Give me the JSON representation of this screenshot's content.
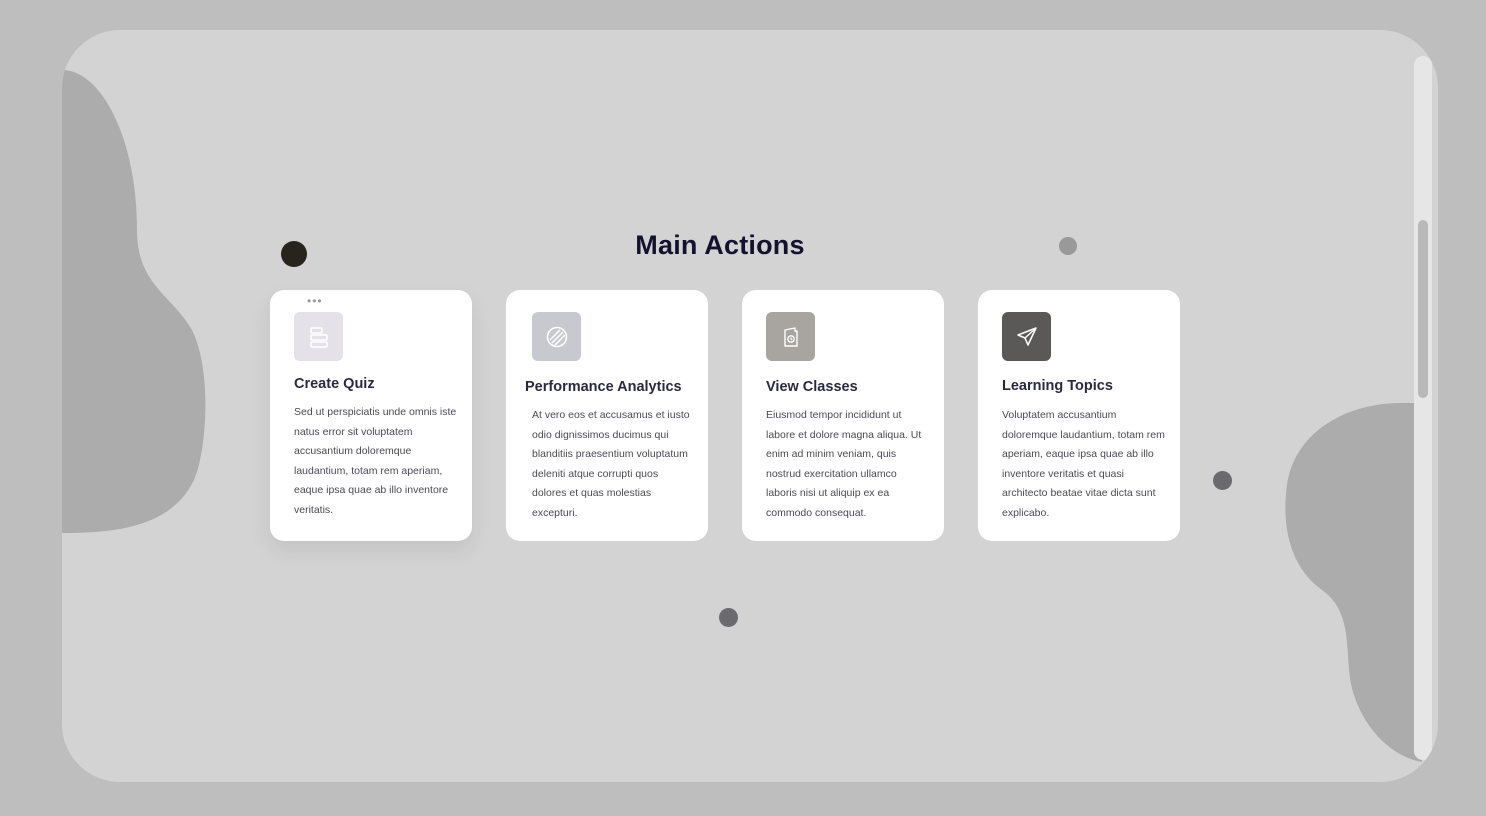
{
  "page": {
    "title": "Main Actions"
  },
  "cards": [
    {
      "title": "Create Quiz",
      "text": "Sed ut perspiciatis unde omnis iste natus error sit voluptatem accusantium doloremque laudantium, totam rem aperiam, eaque ipsa quae ab illo inventore veritatis.",
      "icon": "stacked-layers-icon",
      "icon_bg": "#e4e2e8",
      "icon_fg": "#ffffff",
      "menu": "•••"
    },
    {
      "title": "Performance Analytics",
      "text": "At vero eos et accusamus et iusto odio dignissimos ducimus qui blanditiis praesentium voluptatum deleniti atque corrupti quos dolores et quas molestias excepturi.",
      "icon": "striped-circle-icon",
      "icon_bg": "#c8c9ce",
      "icon_fg": "#ffffff"
    },
    {
      "title": "View Classes",
      "text": "Eiusmod tempor incididunt ut labore et dolore magna aliqua. Ut enim ad minim veniam, quis nostrud exercitation ullamco laboris nisi ut aliquip ex ea commodo consequat.",
      "icon": "book-clock-icon",
      "icon_bg": "#a8a4a0",
      "icon_fg": "#ffffff"
    },
    {
      "title": "Learning Topics",
      "text": "Voluptatem accusantium doloremque laudantium, totam rem aperiam, eaque ipsa quae ab illo inventore veritatis et quasi architecto beatae vitae dicta sunt explicabo.",
      "icon": "paper-plane-icon",
      "icon_bg": "#5b5858",
      "icon_fg": "#ffffff"
    }
  ],
  "colors": {
    "background": "#bebebe",
    "frame": "#d3d3d3",
    "blob": "#adacac",
    "title": "#14112e",
    "card": "#ffffff"
  }
}
